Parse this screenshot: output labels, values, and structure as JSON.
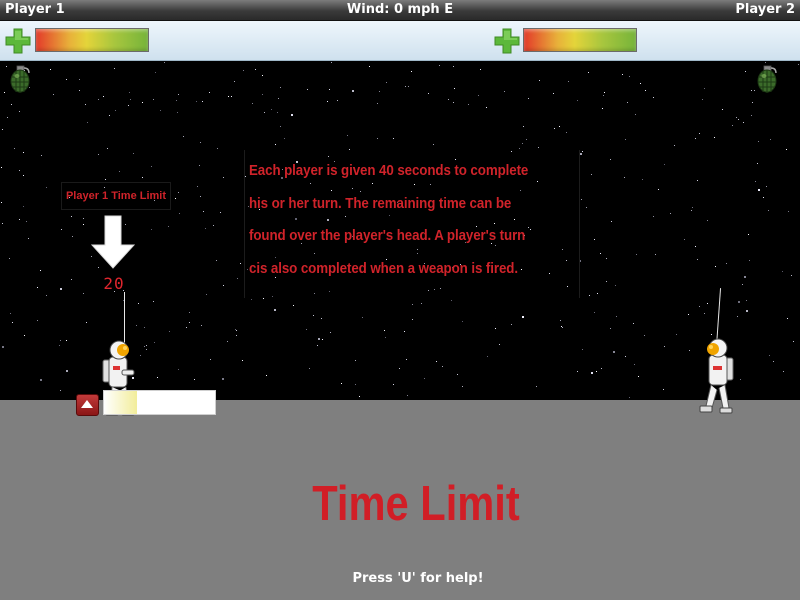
{
  "header": {
    "player1": "Player 1",
    "wind": "Wind: 0 mph E",
    "player2": "Player 2"
  },
  "health": {
    "player1_level": 1.0,
    "player2_level": 1.0
  },
  "tutorial": {
    "text": "Each player is given 40 seconds to complete his or her turn. The remaining time can be found over the player's head. A player's turn cis also completed when a weapon is fired.",
    "indicator_label": "Player 1 Time Limit"
  },
  "timer": {
    "value": "20"
  },
  "power": {
    "level": 0.3
  },
  "footer": {
    "title": "Time Limit",
    "help": "Press 'U' for help!"
  },
  "icons": {
    "health": "plus-icon",
    "weapon": "grenade-icon",
    "power": "arrow-up-icon"
  },
  "colors": {
    "accent_red": "#d0232a",
    "ground": "#7f7f7f",
    "plus_green": "#5cb83a"
  }
}
